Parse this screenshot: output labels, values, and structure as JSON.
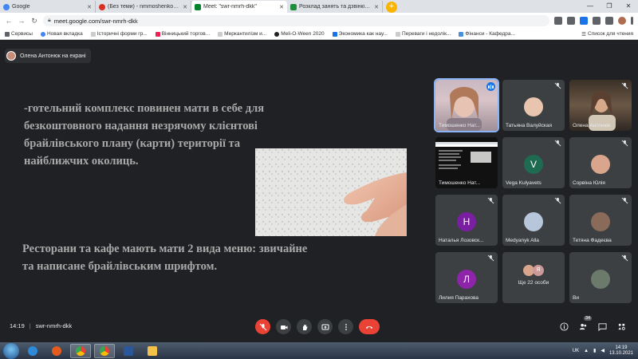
{
  "browser": {
    "tabs": [
      {
        "title": "Google",
        "favicon_color": "#4285f4"
      },
      {
        "title": "(Без теми) - nmmoshenkom@g",
        "favicon_color": "#d93025"
      },
      {
        "title": "Meet: \"swr-nmrh-dkk\"",
        "favicon_color": "#00832d",
        "active": true
      },
      {
        "title": "Розклад занять та дзвінків | \"Б...\"",
        "favicon_color": "#1e8e3e"
      }
    ],
    "new_tab_label": "+",
    "url": "meet.google.com/swr-nmrh-dkk",
    "bookmarks": [
      "Сервисы",
      "Новая вкладка",
      "Історичні форми гр...",
      "Вінницький торгов...",
      "Меркантилізм и...",
      "Meli-O-Ween 2020",
      "Экономика как нау...",
      "Переваги і недолік...",
      "Фінанси - Кафедра..."
    ],
    "reading_list": "Список для чтения"
  },
  "meet": {
    "presenter_label": "Олена Антонюк на екрані",
    "slide": {
      "text1": "-готельний комплекс повинен мати в себе для безкоштовного надання незрячому клієнтові брайлівського плану (карти) території та найближчих околиць.",
      "text2": "Ресторани та кафе мають мати 2 вида меню: звичайне та написане брайлівським шрифтом."
    },
    "participants": [
      {
        "name": "Тимошенко Нат...",
        "type": "video",
        "speaking": true
      },
      {
        "name": "Татьяна Валуйская",
        "type": "avatar",
        "avatar_color": "#e9c5b0"
      },
      {
        "name": "Олена Антонюк",
        "type": "video"
      },
      {
        "name": "Тимошенко Нат...",
        "type": "screen"
      },
      {
        "name": "Vega Kulyavets",
        "type": "letter",
        "letter": "V",
        "avatar_color": "#1e6b52"
      },
      {
        "name": "Сорвіна Юлія",
        "type": "avatar",
        "avatar_color": "#d9a58c"
      },
      {
        "name": "Наталья Лозовск...",
        "type": "letter",
        "letter": "Н",
        "avatar_color": "#7b1fa2"
      },
      {
        "name": "Medyanyk Alla",
        "type": "avatar",
        "avatar_color": "#b7c6da"
      },
      {
        "name": "Тетяна Фадеєва",
        "type": "avatar",
        "avatar_color": "#8a6b5a"
      },
      {
        "name": "Лилия Парахова",
        "type": "letter",
        "letter": "Л",
        "avatar_color": "#8e24aa"
      },
      {
        "name": "Ще 22 особи",
        "type": "group",
        "letter": "Я",
        "avatar_color": "#c99"
      },
      {
        "name": "Ви",
        "type": "avatar",
        "avatar_color": "#6b7a6b"
      }
    ],
    "time": "14:19",
    "meeting_code": "swr-nmrh-dkk",
    "people_count": "34",
    "colors": {
      "accent": "#8ab4f8",
      "danger": "#ea4335",
      "bg": "#202124",
      "tile": "#3c4043"
    }
  },
  "taskbar": {
    "language": "UK",
    "time": "14:19",
    "date": "13.10.2021"
  }
}
